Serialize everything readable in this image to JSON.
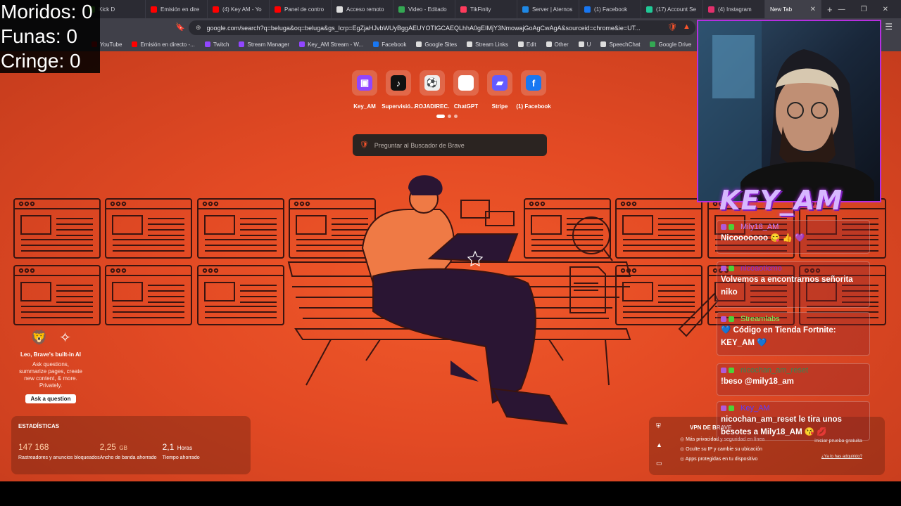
{
  "browser": {
    "tabs": [
      {
        "title": "Kick D",
        "color": "#53fc18"
      },
      {
        "title": "Emisión en dire",
        "color": "#ff0000"
      },
      {
        "title": "(4) Key AM - Yo",
        "color": "#ff0000"
      },
      {
        "title": "Panel de contro",
        "color": "#ff0000"
      },
      {
        "title": "Acceso remoto",
        "color": "#dddddd"
      },
      {
        "title": "Video - Editado",
        "color": "#34a853"
      },
      {
        "title": "TikFinity",
        "color": "#ff3b5c"
      },
      {
        "title": "Server | Aternos",
        "color": "#1e88e5"
      },
      {
        "title": "(1) Facebook",
        "color": "#1877f2"
      },
      {
        "title": "(17) Account Se",
        "color": "#20c997"
      },
      {
        "title": "(4) Instagram",
        "color": "#e1306c"
      }
    ],
    "active_tab": "New Tab",
    "url": "google.com/search?q=beluga&oq=beluga&gs_lcrp=EgZjaHJvbWUyBggAEUYOTIGCAEQLhhA0gEIMjY3NmowajGoAgCwAgA&sourceid=chrome&ie=UT...",
    "bookmarks": [
      {
        "label": "YouTube",
        "color": "#ff0000"
      },
      {
        "label": "Emisión en directo -...",
        "color": "#ff0000"
      },
      {
        "label": "Twitch",
        "color": "#9146ff"
      },
      {
        "label": "Stream Manager",
        "color": "#9146ff"
      },
      {
        "label": "Key_AM Stream - W...",
        "color": "#9146ff"
      },
      {
        "label": "Facebook",
        "color": "#1877f2"
      },
      {
        "label": "Google Sites",
        "color": "#dddddd"
      },
      {
        "label": "Stream Links",
        "color": "#dddddd"
      },
      {
        "label": "Edit",
        "color": "#dddddd"
      },
      {
        "label": "Other",
        "color": "#dddddd"
      },
      {
        "label": "U",
        "color": "#dddddd"
      },
      {
        "label": "SpeechChat",
        "color": "#dddddd"
      },
      {
        "label": "Google Drive",
        "color": "#34a853"
      }
    ]
  },
  "ntp": {
    "top_sites": [
      {
        "label": "Key_AM",
        "color": "#9146ff",
        "icon": "twitch-icon"
      },
      {
        "label": "Supervisió...",
        "color": "#111111",
        "icon": "tiktok-icon"
      },
      {
        "label": "ROJADIREC...",
        "color": "#eeeeee",
        "icon": "ball-icon"
      },
      {
        "label": "ChatGPT",
        "color": "#ffffff",
        "icon": "chatgpt-icon"
      },
      {
        "label": "Stripe",
        "color": "#635bff",
        "icon": "stripe-icon"
      },
      {
        "label": "(1) Facebook",
        "color": "#1877f2",
        "icon": "facebook-icon"
      }
    ],
    "search_placeholder": "Preguntar al Buscador de Brave",
    "leo": {
      "title": "Leo, Brave's built-in AI",
      "desc_lines": [
        "Ask questions,",
        "summarize pages, create",
        "new content, & more.",
        "Privately."
      ],
      "button": "Ask a question"
    },
    "stats": {
      "heading": "ESTADÍSTICAS",
      "items": [
        {
          "value": "147 168",
          "unit": "",
          "label": "Rastreadores y anuncios bloqueados"
        },
        {
          "value": "2,25",
          "unit": "GB",
          "label": "Ancho de banda ahorrado"
        },
        {
          "value": "2,1",
          "unit": "Horas",
          "label": "Tiempo ahorrado"
        }
      ]
    },
    "vpn": {
      "title": "VPN DE BRAVE",
      "features": [
        "Más privacidad y seguridad en línea",
        "Oculte su IP y cambie su ubicación",
        "Apps protegidas en tu dispositivo"
      ],
      "button": "Iniciar prueba gratuita",
      "link": "¿Ya lo has adquirido?"
    }
  },
  "overlay": {
    "counters": [
      "Moridos: 0",
      "Funas: 0",
      "Cringe: 0"
    ],
    "brand": "KEY_AM",
    "chat": [
      {
        "user": "Mily18_AM",
        "color": "#c77dff",
        "text": "Nicooooooo 😋 👍 💜"
      },
      {
        "user": "nicoaoticmo",
        "color": "#8a2be2",
        "text": "Volvemos a encontrarnos señorita niko"
      },
      {
        "user": "Streamlabs",
        "color": "#7fff5a",
        "text": "💙 Código en Tienda Fortnite: KEY_AM 💙"
      },
      {
        "user": "nicochan_am_reset",
        "color": "#2e8b57",
        "text": "!beso @mily18_am"
      },
      {
        "user": "Key_AM",
        "color": "#5b3bff",
        "text": "nicochan_am_reset le tira unos besotes a Mily18_AM 😘 💋"
      }
    ]
  }
}
